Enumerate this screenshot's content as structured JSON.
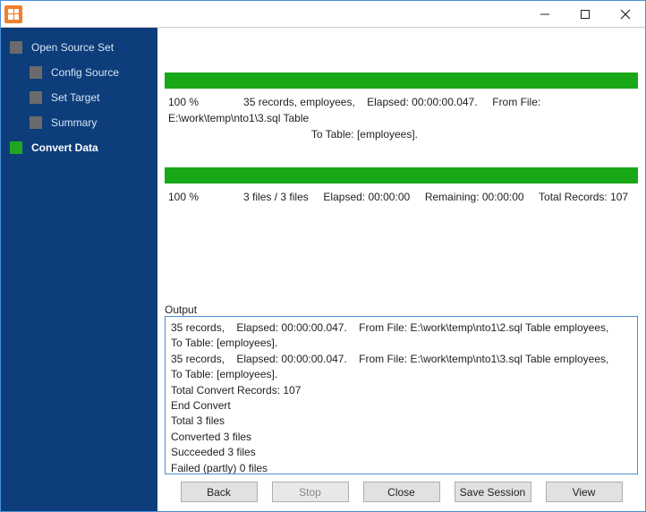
{
  "sidebar": {
    "items": [
      {
        "label": "Open Source Set",
        "active": false,
        "child": false
      },
      {
        "label": "Config Source",
        "active": false,
        "child": true
      },
      {
        "label": "Set Target",
        "active": false,
        "child": true
      },
      {
        "label": "Summary",
        "active": false,
        "child": true
      },
      {
        "label": "Convert Data",
        "active": true,
        "child": false
      }
    ]
  },
  "progress1": {
    "percent": "100 %",
    "details": "35 records, employees,",
    "elapsed_label": "Elapsed: 00:00:00.047.",
    "from_label": "From File: E:\\work\\temp\\nto1\\3.sql Table",
    "to_label": "To Table: [employees]."
  },
  "progress2": {
    "percent": "100 %",
    "files": "3 files / 3 files",
    "elapsed": "Elapsed: 00:00:00",
    "remaining": "Remaining: 00:00:00",
    "total": "Total Records: 107"
  },
  "output": {
    "label": "Output",
    "lines": [
      "35 records,    Elapsed: 00:00:00.047.    From File: E:\\work\\temp\\nto1\\2.sql Table employees,    To Table: [employees].",
      "35 records,    Elapsed: 00:00:00.047.    From File: E:\\work\\temp\\nto1\\3.sql Table employees,    To Table: [employees].",
      "Total Convert Records: 107",
      "End Convert",
      "Total 3 files",
      "Converted 3 files",
      "Succeeded 3 files",
      "Failed (partly) 0 files"
    ]
  },
  "buttons": {
    "back": "Back",
    "stop": "Stop",
    "close": "Close",
    "save_session": "Save Session",
    "view": "View"
  }
}
